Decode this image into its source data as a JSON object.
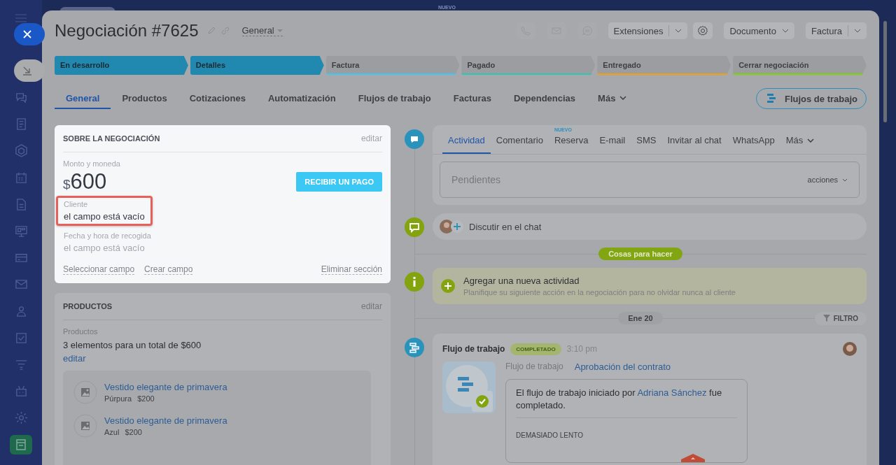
{
  "backdrop": {
    "badge": "NUEVO"
  },
  "window": {
    "title": "Negociación #7625",
    "category": "General"
  },
  "toolbar": {
    "buttons": [
      {
        "label": "Extensiones",
        "kind": "split"
      },
      {
        "label": "Documento",
        "kind": "dropdown"
      },
      {
        "label": "Factura",
        "kind": "split"
      }
    ]
  },
  "stages": [
    {
      "label": "En desarrollo",
      "selected": true,
      "color": "#2189b0"
    },
    {
      "label": "Detalles",
      "selected": true,
      "color": "#2189b0"
    },
    {
      "label": "Factura",
      "selected": false,
      "color": "#3bc8f5"
    },
    {
      "label": "Pagado",
      "selected": false,
      "color": "#2ec7b6"
    },
    {
      "label": "Entregado",
      "selected": false,
      "color": "#f59e0b"
    },
    {
      "label": "Cerrar negociación",
      "selected": false,
      "color": "#7bd500"
    }
  ],
  "tabs": [
    {
      "label": "General",
      "selected": true
    },
    {
      "label": "Productos",
      "selected": false
    },
    {
      "label": "Cotizaciones",
      "selected": false
    },
    {
      "label": "Automatización",
      "selected": false
    },
    {
      "label": "Flujos de trabajo",
      "selected": false
    },
    {
      "label": "Facturas",
      "selected": false
    },
    {
      "label": "Dependencias",
      "selected": false
    }
  ],
  "more_tab": "Más",
  "workflows_button": "Flujos de trabajo",
  "about": {
    "title": "SOBRE LA NEGOCIACIÓN",
    "edit": "editar",
    "amount_label": "Monto y moneda",
    "currency": "$",
    "amount": "600",
    "pay_button": "RECIBIR UN PAGO",
    "fields": [
      {
        "label": "Cliente",
        "value": "el campo está vacío",
        "highlighted": true
      },
      {
        "label": "Fecha y hora de recogida",
        "value": "el campo está vacío",
        "highlighted": false
      }
    ],
    "links": [
      "Seleccionar campo",
      "Crear campo"
    ],
    "remove": "Eliminar sección"
  },
  "products": {
    "title": "PRODUCTOS",
    "edit": "editar",
    "label": "Productos",
    "summary": "3 elementos para un total de $600",
    "edit_link": "editar",
    "items": [
      {
        "name": "Vestido elegante de primavera",
        "variant": "Púrpura",
        "price": "$200"
      },
      {
        "name": "Vestido elegante de primavera",
        "variant": "Azul",
        "price": "$200"
      }
    ]
  },
  "activity": {
    "tabs": [
      {
        "label": "Actividad",
        "selected": true
      },
      {
        "label": "Comentario",
        "selected": false
      },
      {
        "label": "Reserva",
        "selected": false,
        "badge": "NUEVO"
      },
      {
        "label": "E-mail",
        "selected": false
      },
      {
        "label": "SMS",
        "selected": false
      },
      {
        "label": "Invitar al chat",
        "selected": false
      },
      {
        "label": "WhatsApp",
        "selected": false
      }
    ],
    "more": "Más",
    "placeholder": "Pendientes",
    "actions": "acciones"
  },
  "chat": {
    "label": "Discutir en el chat"
  },
  "todo_badge": "Cosas para hacer",
  "add_activity": {
    "title": "Agregar una nueva actividad",
    "subtitle": "Planifique su siguiente acción en la negociación para no olvidar nunca al cliente"
  },
  "date": "Ene 20",
  "filter": "FILTRO",
  "workflow": {
    "title": "Flujo de trabajo",
    "status": "COMPLETADO",
    "time": "3:10 pm",
    "label": "Flujo de trabajo",
    "link": "Aprobación del contrato",
    "message_before": "El flujo de trabajo iniciado por",
    "person": "Adriana Sánchez",
    "message_after": "fue completado.",
    "section": "DEMASIADO LENTO"
  }
}
